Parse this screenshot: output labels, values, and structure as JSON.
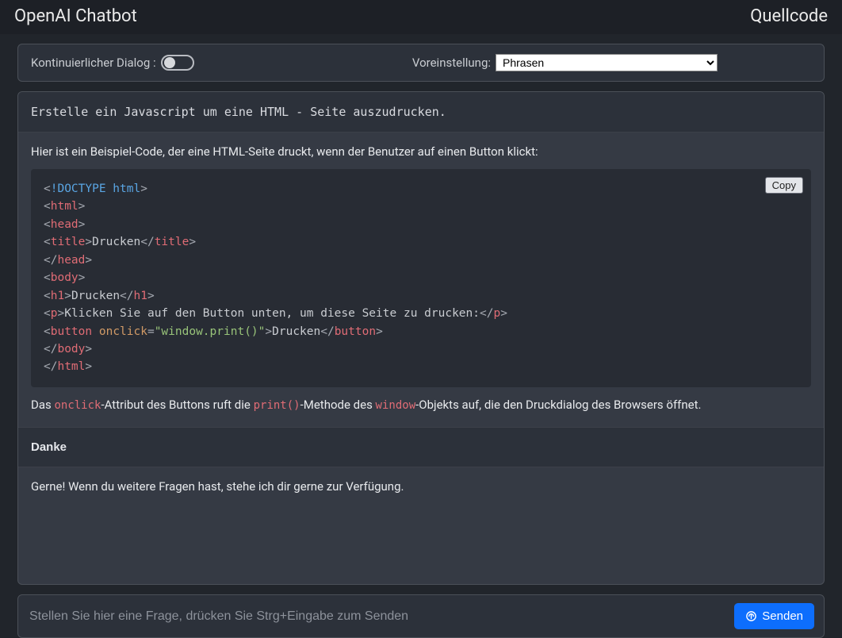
{
  "header": {
    "title": "OpenAI Chatbot",
    "right_link": "Quellcode"
  },
  "settings": {
    "dialog_label": "Kontinuierlicher Dialog :",
    "preset_label": "Voreinstellung:",
    "preset_value": "Phrasen"
  },
  "chat": {
    "user1": "Erstelle ein Javascript um eine HTML - Seite auszudrucken.",
    "assist1_intro": "Hier ist ein Beispiel-Code, der eine HTML-Seite druckt, wenn der Benutzer auf einen Button klickt:",
    "code_lines": [
      [
        {
          "c": "tok-punc",
          "t": "<"
        },
        {
          "c": "tok-doctype",
          "t": "!DOCTYPE html"
        },
        {
          "c": "tok-punc",
          "t": ">"
        }
      ],
      [
        {
          "c": "tok-punc",
          "t": "<"
        },
        {
          "c": "tok-tag",
          "t": "html"
        },
        {
          "c": "tok-punc",
          "t": ">"
        }
      ],
      [
        {
          "c": "tok-punc",
          "t": "<"
        },
        {
          "c": "tok-tag",
          "t": "head"
        },
        {
          "c": "tok-punc",
          "t": ">"
        }
      ],
      [
        {
          "c": "tok-punc",
          "t": "<"
        },
        {
          "c": "tok-tag",
          "t": "title"
        },
        {
          "c": "tok-punc",
          "t": ">"
        },
        {
          "c": "tok-text",
          "t": "Drucken"
        },
        {
          "c": "tok-punc",
          "t": "</"
        },
        {
          "c": "tok-tag",
          "t": "title"
        },
        {
          "c": "tok-punc",
          "t": ">"
        }
      ],
      [
        {
          "c": "tok-punc",
          "t": "</"
        },
        {
          "c": "tok-tag",
          "t": "head"
        },
        {
          "c": "tok-punc",
          "t": ">"
        }
      ],
      [
        {
          "c": "tok-punc",
          "t": "<"
        },
        {
          "c": "tok-tag",
          "t": "body"
        },
        {
          "c": "tok-punc",
          "t": ">"
        }
      ],
      [
        {
          "c": "tok-punc",
          "t": "<"
        },
        {
          "c": "tok-tag",
          "t": "h1"
        },
        {
          "c": "tok-punc",
          "t": ">"
        },
        {
          "c": "tok-text",
          "t": "Drucken"
        },
        {
          "c": "tok-punc",
          "t": "</"
        },
        {
          "c": "tok-tag",
          "t": "h1"
        },
        {
          "c": "tok-punc",
          "t": ">"
        }
      ],
      [
        {
          "c": "tok-punc",
          "t": "<"
        },
        {
          "c": "tok-tag",
          "t": "p"
        },
        {
          "c": "tok-punc",
          "t": ">"
        },
        {
          "c": "tok-text",
          "t": "Klicken Sie auf den Button unten, um diese Seite zu drucken:"
        },
        {
          "c": "tok-punc",
          "t": "</"
        },
        {
          "c": "tok-tag",
          "t": "p"
        },
        {
          "c": "tok-punc",
          "t": ">"
        }
      ],
      [
        {
          "c": "tok-punc",
          "t": "<"
        },
        {
          "c": "tok-tag",
          "t": "button"
        },
        {
          "c": "tok-text",
          "t": " "
        },
        {
          "c": "tok-attr",
          "t": "onclick"
        },
        {
          "c": "tok-punc",
          "t": "="
        },
        {
          "c": "tok-str",
          "t": "\"window.print()\""
        },
        {
          "c": "tok-punc",
          "t": ">"
        },
        {
          "c": "tok-text",
          "t": "Drucken"
        },
        {
          "c": "tok-punc",
          "t": "</"
        },
        {
          "c": "tok-tag",
          "t": "button"
        },
        {
          "c": "tok-punc",
          "t": ">"
        }
      ],
      [
        {
          "c": "tok-punc",
          "t": "</"
        },
        {
          "c": "tok-tag",
          "t": "body"
        },
        {
          "c": "tok-punc",
          "t": ">"
        }
      ],
      [
        {
          "c": "tok-punc",
          "t": "</"
        },
        {
          "c": "tok-tag",
          "t": "html"
        },
        {
          "c": "tok-punc",
          "t": ">"
        }
      ]
    ],
    "copy_label": "Copy",
    "note_pre": "Das ",
    "note_code1": "onclick",
    "note_mid1": "-Attribut des Buttons ruft die ",
    "note_code2": "print()",
    "note_mid2": "-Methode des ",
    "note_code3": "window",
    "note_tail": "-Objekts auf, die den Druckdialog des Browsers öffnet.",
    "user2": "Danke",
    "assist2": "Gerne! Wenn du weitere Fragen hast, stehe ich dir gerne zur Verfügung."
  },
  "input": {
    "placeholder": "Stellen Sie hier eine Frage, drücken Sie Strg+Eingabe zum Senden",
    "send_label": "Senden"
  }
}
